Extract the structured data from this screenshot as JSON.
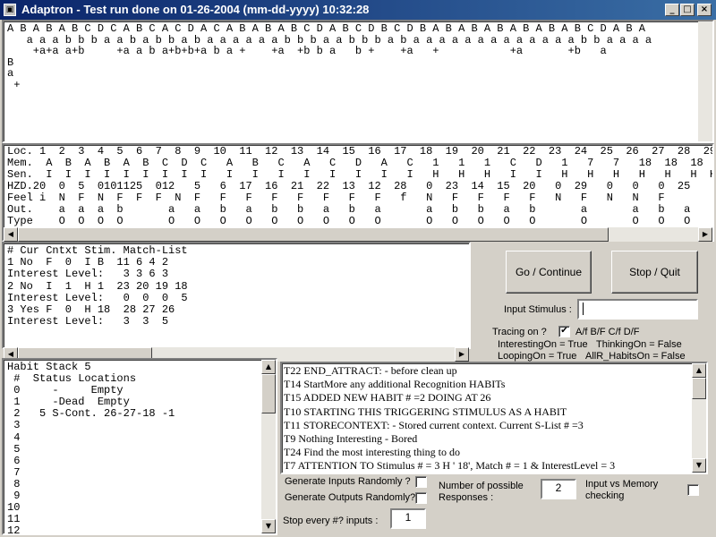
{
  "window": {
    "title": "Adaptron  -  Test run done on 01-26-2004 (mm-dd-yyyy) 10:32:28",
    "app_icon": "app-icon",
    "minimize": "_",
    "maximize": "□",
    "close": "×"
  },
  "stimulus_panel": {
    "lines": [
      "A B A B A B C D C A B C A C D A C A B A B A B C D A B C D B C D B A B A B A B A B A B A B C D A B A",
      "   a a a b b b a a b a b b a b a a a a a a b b b a a b b b a b a a a a a a a a a a a a a b b a a a a",
      "    +a+a a+b     +a a b a+b+b+a b a +    +a  +b b a   b +    +a   +           +a       +b   a",
      "B",
      "a",
      " +"
    ]
  },
  "memory_table": {
    "rows": [
      "Loc. 1  2  3  4  5  6  7  8  9  10  11  12  13  14  15  16  17  18  19  20  21  22  23  24  25  26  27  28  29",
      "Mem.  A  B  A  B  A  B  C  D  C   A   B   C   A   C   D   A   C   1   1   1   C   D   1   7   7   18  18  18  7",
      "Sen.  I  I  I  I  I  I  I  I  I   I   I   I   I   I   I   I   I   H   H   H   I   I   H   H   H   H   H   H  H",
      "HZD.20  0  5  0101125  012   5   6  17  16  21  22  13  12  28   0  23  14  15  20   0  29   0   0   0  25",
      "Feel i  N  F  N  F  F  F  N  F   F   F   F   F   F   F   F   f   N   F   F   F   F   N   F   N   N   F",
      "Out.    a  a  a  b       a   a   b   a   b   b   a   b   a       a   b   b   a   b       a       a   b   a",
      "Type    O  O  O  O       O   O   O   O   O   O   O   O   O       O   O   O   O   O       O       O   O   O"
    ]
  },
  "context_panel": {
    "lines": [
      "# Cur Cntxt Stim. Match-List",
      "1 No  F  0  I B  11 6 4 2",
      "Interest Level:   3 3 6 3",
      "2 No  I  1  H 1  23 20 19 18",
      "Interest Level:   0  0  0  5",
      "3 Yes F  0  H 18  28 27 26",
      "Interest Level:   3  3  5"
    ]
  },
  "habit_panel": {
    "lines": [
      "Habit Stack 5",
      " #  Status Locations",
      " 0     -     Empty",
      " 1     -Dead  Empty",
      " 2   5 S-Cont. 26-27-18 -1",
      " 3",
      " 4",
      " 5",
      " 6",
      " 7",
      " 8",
      " 9",
      "10",
      "11",
      "12"
    ]
  },
  "log_panel": {
    "lines": [
      "T22 END_ATTRACT: - before clean up",
      "T14 StartMore any additional Recognition HABITs",
      "T15 ADDED NEW  HABIT # =2 DOING AT  26",
      "T10 STARTING THIS TRIGGERING STIMULUS AS A HABIT",
      "T11 STORECONTEXT: - Stored current context. Current S-List # =3",
      "T9  Nothing Interesting - Bored",
      "T24 Find the most interesting thing to do",
      "T7  ATTENTION TO Stimulus # = 3 H ' 18', Match # = 1 & InterestLevel = 3"
    ]
  },
  "controls": {
    "go_label": "Go / Continue",
    "stop_label": "Stop / Quit",
    "input_stimulus_label": "Input Stimulus :",
    "input_stimulus_value": "",
    "tracing_label": "Tracing on ?",
    "tracing_checked": "✔",
    "tracing_flags": "A/f  B/F  C/f  D/F",
    "interesting_on": "InterestingOn = True",
    "thinking_on": "ThinkingOn = False",
    "looping_on": "LoopingOn = True",
    "allr_habits_on": "AllR_HabitsOn = False",
    "gen_inputs_label": "Generate Inputs Randomly ?",
    "gen_outputs_label": "Generate Outputs Randomly?",
    "num_responses_label_1": "Number of possible",
    "num_responses_label_2": "Responses :",
    "num_responses_value": "2",
    "input_vs_memory_label_1": "Input vs Memory",
    "input_vs_memory_label_2": "checking",
    "stop_every_label": "Stop every #? inputs :",
    "stop_every_value": "1"
  },
  "icons": {
    "scroll_left": "◀",
    "scroll_right": "▶",
    "scroll_up": "▲",
    "scroll_down": "▼"
  }
}
